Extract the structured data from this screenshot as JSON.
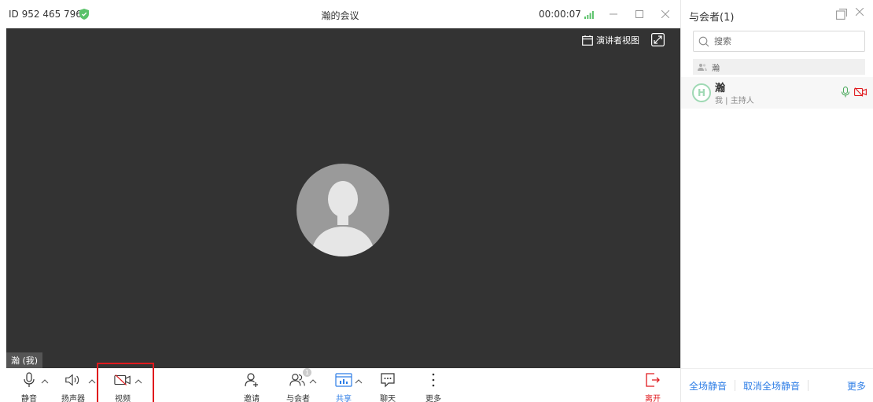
{
  "titlebar": {
    "meeting_id": "ID 952 465 796",
    "title": "瀚的会议",
    "timer": "00:00:07"
  },
  "video": {
    "presenter_view_label": "演讲者视图",
    "self_label": "瀚 (我)"
  },
  "toolbar": {
    "mute_label": "静音",
    "speaker_label": "扬声器",
    "video_label": "视频",
    "invite_label": "邀请",
    "participants_label": "与会者",
    "participants_badge": "1",
    "share_label": "共享",
    "chat_label": "聊天",
    "more_label": "更多",
    "leave_label": "离开"
  },
  "panel": {
    "title": "与会者(1)",
    "search_placeholder": "搜索",
    "group_name": "瀚",
    "member": {
      "name": "瀚",
      "role": "我 | 主持人",
      "avatar_letter": "H"
    },
    "footer": {
      "mute_all": "全场静音",
      "unmute_all": "取消全场静音",
      "more": "更多"
    }
  },
  "colors": {
    "accent": "#2d7de6",
    "leave": "#e0191d",
    "video_bg": "#333333",
    "highlight": "#e0191d",
    "shield": "#5ac26a"
  }
}
